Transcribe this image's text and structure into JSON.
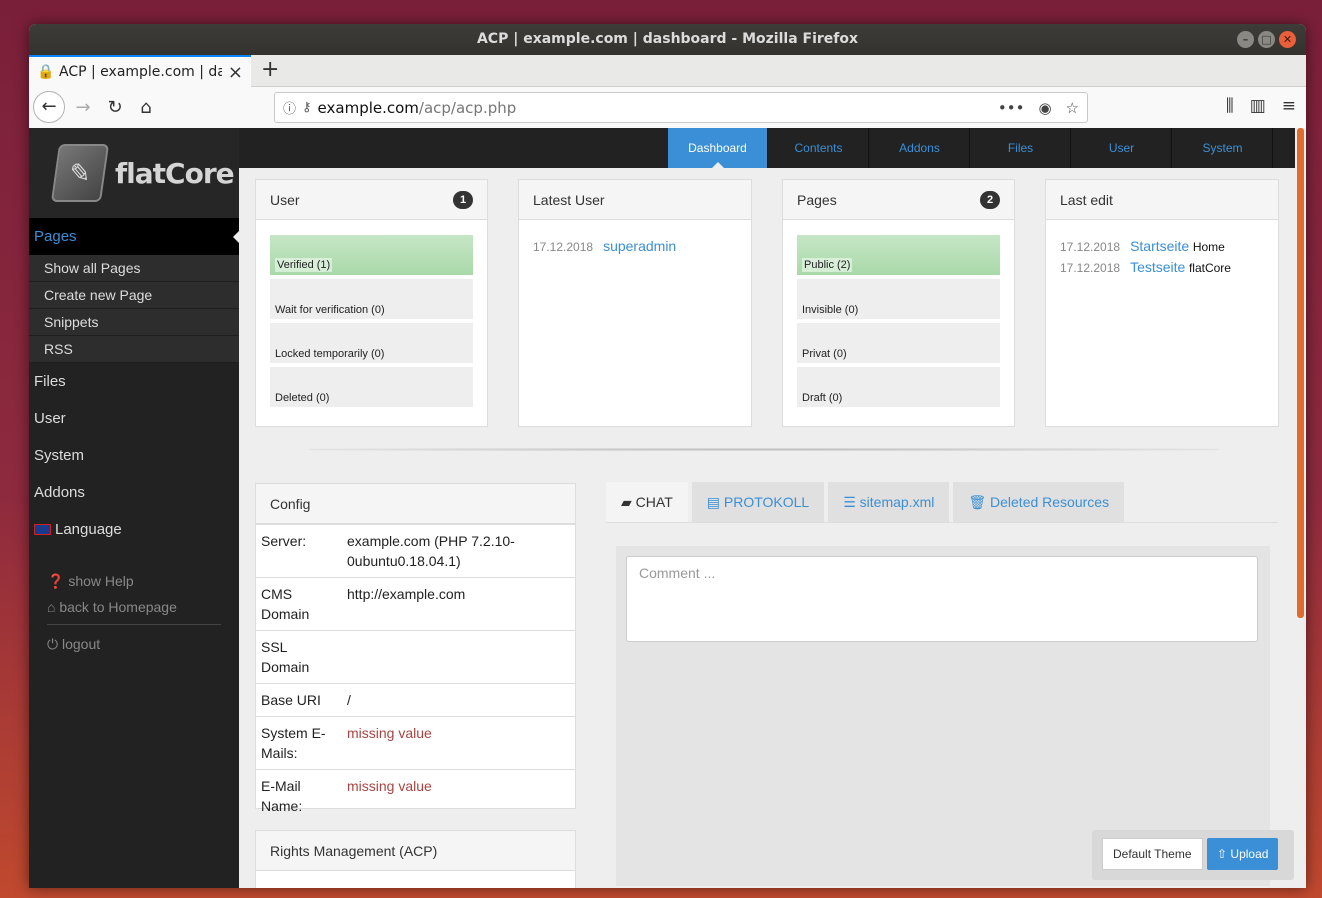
{
  "window": {
    "title": "ACP | example.com | dashboard - Mozilla Firefox"
  },
  "browser": {
    "tab_title": "ACP | example.com | dashboard",
    "url_domain": "example.com",
    "url_path": "/acp/acp.php"
  },
  "brand": {
    "name": "flatCore"
  },
  "sidebar": {
    "active": "Pages",
    "sub": [
      "Show all Pages",
      "Create new Page",
      "Snippets",
      "RSS"
    ],
    "items": [
      "Files",
      "User",
      "System",
      "Addons",
      "Language"
    ],
    "extra": [
      "show Help",
      "back to Homepage",
      "logout"
    ]
  },
  "topnav": [
    "Dashboard",
    "Contents",
    "Addons",
    "Files",
    "User",
    "System"
  ],
  "cards": {
    "user": {
      "title": "User",
      "count": "1",
      "bars": [
        {
          "label": "Verified (1)",
          "value": 1
        },
        {
          "label": "Wait for verification (0)",
          "value": 0
        },
        {
          "label": "Locked temporarily (0)",
          "value": 0
        },
        {
          "label": "Deleted (0)",
          "value": 0
        }
      ]
    },
    "latest": {
      "title": "Latest User",
      "date": "17.12.2018",
      "name": "superadmin"
    },
    "pages": {
      "title": "Pages",
      "count": "2",
      "bars": [
        {
          "label": "Public (2)",
          "value": 2
        },
        {
          "label": "Invisible (0)",
          "value": 0
        },
        {
          "label": "Privat (0)",
          "value": 0
        },
        {
          "label": "Draft (0)",
          "value": 0
        }
      ]
    },
    "lastedit": {
      "title": "Last edit",
      "rows": [
        {
          "date": "17.12.2018",
          "link": "Startseite",
          "name": "Home"
        },
        {
          "date": "17.12.2018",
          "link": "Testseite",
          "name": "flatCore"
        }
      ]
    }
  },
  "config": {
    "title": "Config",
    "rows": [
      {
        "k": "Server:",
        "v": "example.com (PHP 7.2.10-0ubuntu0.18.04.1)"
      },
      {
        "k": "CMS Domain",
        "v": "http://example.com"
      },
      {
        "k": "SSL Domain",
        "v": ""
      },
      {
        "k": "Base URI",
        "v": "/"
      },
      {
        "k": "System E-Mails:",
        "v": "missing value"
      },
      {
        "k": "E-Mail Name:",
        "v": "missing value"
      }
    ]
  },
  "rights": {
    "title": "Rights Management (ACP)"
  },
  "tabs": [
    "CHAT",
    "PROTOKOLL",
    "sitemap.xml",
    "Deleted Resources"
  ],
  "chat": {
    "placeholder": "Comment ..."
  },
  "buttons": {
    "theme": "Default Theme",
    "upload": "Upload"
  }
}
